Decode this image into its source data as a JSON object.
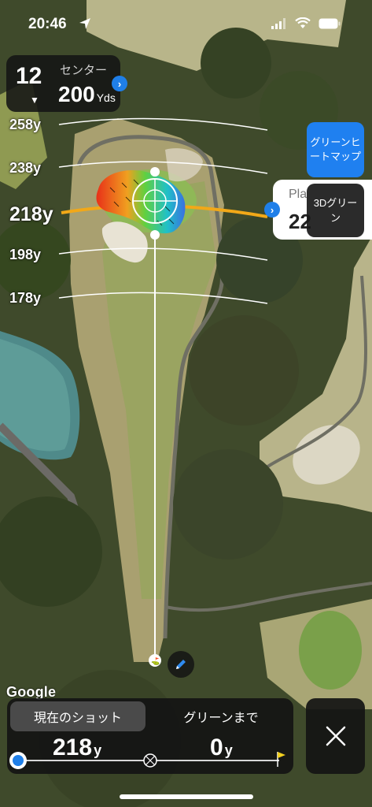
{
  "status_bar": {
    "time": "20:46"
  },
  "hole": {
    "number": "12",
    "target": "センター",
    "distance": "200",
    "unit": "Yds"
  },
  "distance_labels": [
    "258y",
    "238y",
    "218y",
    "198y",
    "178y"
  ],
  "heatmap_button": "グリーンヒートマップ",
  "plays_like": {
    "label": "Pla",
    "value": "22"
  },
  "green_3d_button": "3Dグリーン",
  "map_attribution": "Google",
  "bottom_panel": {
    "tab_current": "現在のショット",
    "tab_to_green": "グリーンまで",
    "shot_distance": "218",
    "green_distance": "0",
    "unit": "y"
  },
  "colors": {
    "accent_blue": "#1f7fe8",
    "arc_orange": "#f2a818",
    "panel_dark": "#141414"
  },
  "icons": [
    "location-arrow-icon",
    "signal-icon",
    "wifi-icon",
    "battery-icon",
    "chevron-right-icon",
    "pencil-icon",
    "crosshair-icon",
    "flag-icon",
    "close-icon"
  ]
}
